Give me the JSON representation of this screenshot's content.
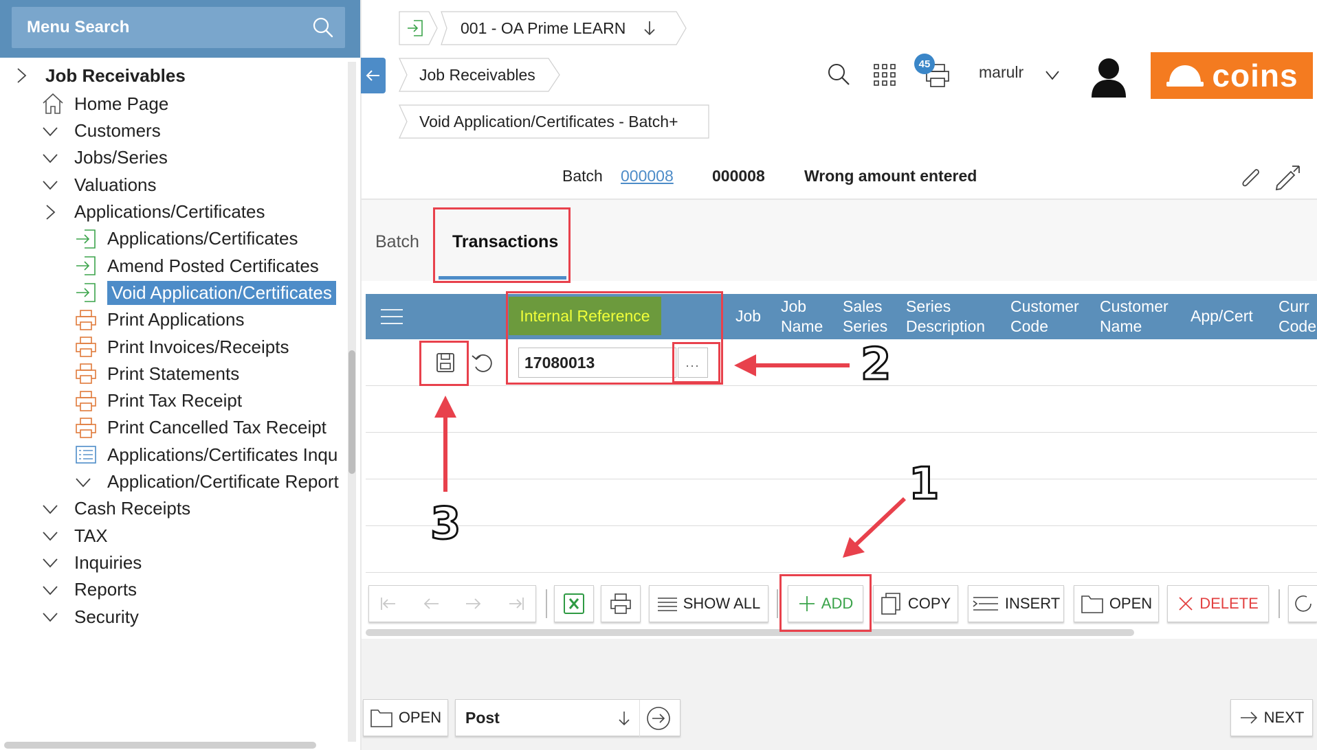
{
  "sidebar": {
    "search_placeholder": "Menu Search",
    "items": [
      {
        "label": "Job Receivables",
        "icon": "chevron-right-icon",
        "level": 0
      },
      {
        "label": "Home Page",
        "icon": "home-icon",
        "level": 1
      },
      {
        "label": "Customers",
        "icon": "chevron-down-icon",
        "level": 1
      },
      {
        "label": "Jobs/Series",
        "icon": "chevron-down-icon",
        "level": 1
      },
      {
        "label": "Valuations",
        "icon": "chevron-down-icon",
        "level": 1
      },
      {
        "label": "Applications/Certificates",
        "icon": "chevron-right-icon",
        "level": 1
      },
      {
        "label": "Applications/Certificates",
        "icon": "enter-icon",
        "level": 2
      },
      {
        "label": "Amend Posted Certificates",
        "icon": "enter-icon",
        "level": 2
      },
      {
        "label": "Void Application/Certificates",
        "icon": "enter-icon",
        "level": 2,
        "active": true
      },
      {
        "label": "Print Applications",
        "icon": "printer-icon",
        "level": 2
      },
      {
        "label": "Print Invoices/Receipts",
        "icon": "printer-icon",
        "level": 2
      },
      {
        "label": "Print Statements",
        "icon": "printer-icon",
        "level": 2
      },
      {
        "label": "Print Tax Receipt",
        "icon": "printer-icon",
        "level": 2
      },
      {
        "label": "Print Cancelled Tax Receipt",
        "icon": "printer-icon",
        "level": 2
      },
      {
        "label": "Applications/Certificates Inqu",
        "icon": "list-icon",
        "level": 2
      },
      {
        "label": "Application/Certificate Report",
        "icon": "chevron-down-icon",
        "level": 2
      },
      {
        "label": "Cash Receipts",
        "icon": "chevron-down-icon",
        "level": 1
      },
      {
        "label": "TAX",
        "icon": "chevron-down-icon",
        "level": 1
      },
      {
        "label": "Inquiries",
        "icon": "chevron-down-icon",
        "level": 1
      },
      {
        "label": "Reports",
        "icon": "chevron-down-icon",
        "level": 1
      },
      {
        "label": "Security",
        "icon": "chevron-down-icon",
        "level": 1
      }
    ]
  },
  "header": {
    "company": "001 - OA Prime LEARN",
    "breadcrumb_module": "Job Receivables",
    "breadcrumb_page": "Void Application/Certificates - Batch+",
    "notification_count": "45",
    "username": "marulr",
    "logo_text": "coins"
  },
  "batch": {
    "label": "Batch",
    "link": "000008",
    "number": "000008",
    "description": "Wrong amount entered"
  },
  "tabs": [
    {
      "label": "Batch",
      "active": false
    },
    {
      "label": "Transactions",
      "active": true
    }
  ],
  "grid": {
    "columns": [
      {
        "label": "Internal Reference"
      },
      {
        "label": "Job"
      },
      {
        "label": "Job\nName"
      },
      {
        "label": "Sales\nSeries"
      },
      {
        "label": "Series\nDescription"
      },
      {
        "label": "Customer\nCode"
      },
      {
        "label": "Customer\nName"
      },
      {
        "label": "App/Cert"
      },
      {
        "label": "Curr\nCode"
      }
    ],
    "rows": [
      {
        "internal_reference": "17080013"
      }
    ],
    "lookup_label": "..."
  },
  "toolbar": {
    "show_all": "SHOW ALL",
    "add": "ADD",
    "copy": "COPY",
    "insert": "INSERT",
    "open": "OPEN",
    "delete": "DELETE"
  },
  "footer": {
    "open": "OPEN",
    "action": "Post",
    "next": "NEXT"
  },
  "annotations": {
    "n1": "1",
    "n2": "2",
    "n3": "3"
  },
  "colors": {
    "accent": "#4d8cc8",
    "header_blue": "#5b8fba",
    "logo_orange": "#f47b20",
    "annotation_red": "#e8414c",
    "internal_ref_bg": "#6c9a3d",
    "internal_ref_text": "#f0ff3a"
  }
}
